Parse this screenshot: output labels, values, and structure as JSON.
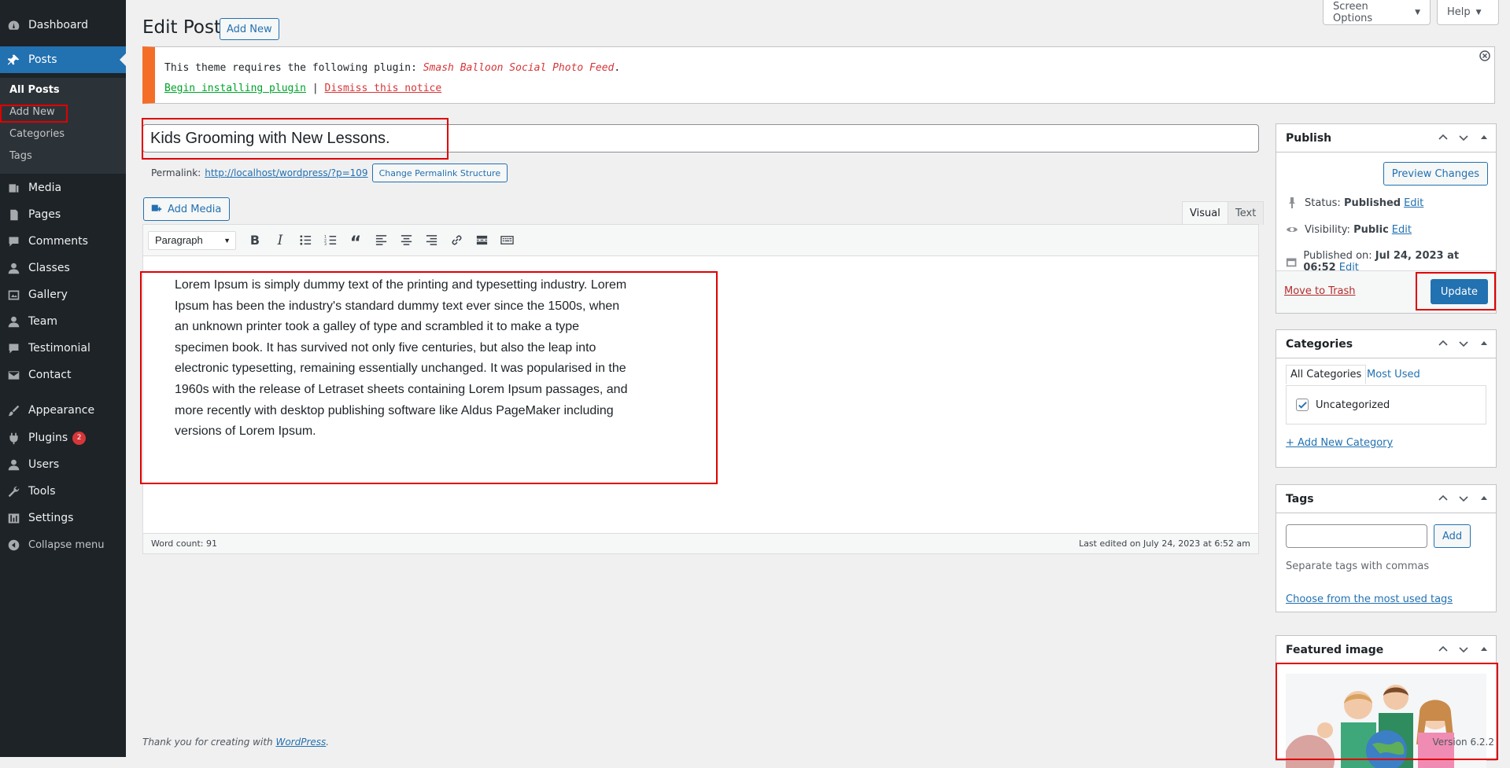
{
  "sidebar": {
    "dashboard": "Dashboard",
    "posts": "Posts",
    "submenu": {
      "all_posts": "All Posts",
      "add_new": "Add New",
      "categories": "Categories",
      "tags": "Tags"
    },
    "media": "Media",
    "pages": "Pages",
    "comments": "Comments",
    "classes": "Classes",
    "gallery": "Gallery",
    "team": "Team",
    "testimonial": "Testimonial",
    "contact": "Contact",
    "appearance": "Appearance",
    "plugins": "Plugins",
    "plugins_badge": "2",
    "users": "Users",
    "tools": "Tools",
    "settings": "Settings",
    "collapse": "Collapse menu"
  },
  "screen_meta": {
    "screen_options": "Screen Options",
    "help": "Help"
  },
  "header": {
    "title": "Edit Post",
    "add_new": "Add New"
  },
  "notice": {
    "text_prefix": "This theme requires the following plugin: ",
    "plugin_name": "Smash Balloon Social Photo Feed",
    "text_suffix": ".",
    "begin_link": "Begin installing plugin",
    "separator": " | ",
    "dismiss_link": "Dismiss this notice"
  },
  "post": {
    "title": "Kids Grooming with New Lessons.",
    "permalink_label": "Permalink:",
    "permalink_url": "http://localhost/wordpress/?p=109",
    "permalink_button": "Change Permalink Structure"
  },
  "editor": {
    "add_media": "Add Media",
    "tab_visual": "Visual",
    "tab_text": "Text",
    "format": "Paragraph",
    "content": "Lorem Ipsum is simply dummy text of the printing and typesetting industry. Lorem Ipsum has been the industry's standard dummy text ever since the 1500s, when an unknown printer took a galley of type and scrambled it to make a type specimen book. It has survived not only five centuries, but also the leap into electronic typesetting, remaining essentially unchanged. It was popularised in the 1960s with the release of Letraset sheets containing Lorem Ipsum passages, and more recently with desktop publishing software like Aldus PageMaker including versions of Lorem Ipsum.",
    "word_count": "Word count: 91",
    "last_edited": "Last edited on July 24, 2023 at 6:52 am"
  },
  "publish": {
    "title": "Publish",
    "preview": "Preview Changes",
    "status_label": "Status:",
    "status_value": "Published",
    "visibility_label": "Visibility:",
    "visibility_value": "Public",
    "published_label": "Published on:",
    "published_value": "Jul 24, 2023 at 06:52",
    "edit": "Edit",
    "trash": "Move to Trash",
    "update": "Update"
  },
  "categories": {
    "title": "Categories",
    "tab_all": "All Categories",
    "tab_most_used": "Most Used",
    "items": [
      {
        "label": "Uncategorized",
        "checked": true
      }
    ],
    "add_new": "+ Add New Category"
  },
  "tags": {
    "title": "Tags",
    "add": "Add",
    "hint": "Separate tags with commas",
    "choose": "Choose from the most used tags"
  },
  "featured_image": {
    "title": "Featured image"
  },
  "footer": {
    "thanks_prefix": "Thank you for creating with ",
    "wordpress": "WordPress",
    "thanks_suffix": ".",
    "version": "Version 6.2.2"
  },
  "colors": {
    "sidebar_bg": "#1d2327",
    "accent": "#2271b1",
    "notice_border": "#f56e28",
    "annotation_red": "#e00000"
  }
}
